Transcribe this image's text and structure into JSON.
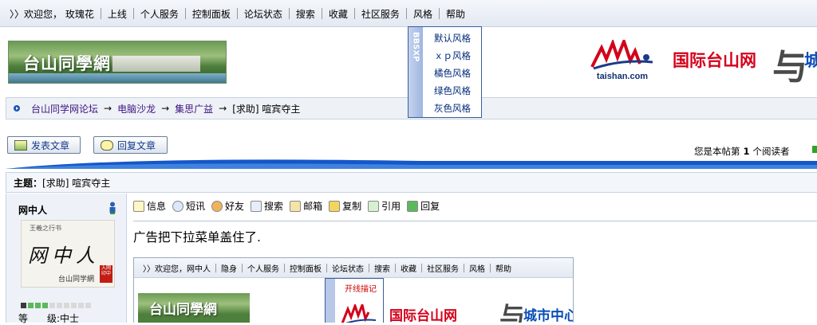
{
  "topnav": {
    "items": [
      "〉〉欢迎您， 玫瑰花",
      "上线",
      "个人服务",
      "控制面板",
      "论坛状态",
      "搜索",
      "收藏",
      "社区服务",
      "风格",
      "帮助"
    ]
  },
  "style_menu": {
    "strip_text": "BBSXP",
    "items": [
      "默认风格",
      "ｘｐ风格",
      "橘色风格",
      "绿色风格",
      "灰色风格"
    ]
  },
  "banner": {
    "logo_text": "台山同學網",
    "partner_domain": "taishan.com",
    "partner_name": "国际台山网",
    "partner_amp": "与",
    "partner_name2": "城"
  },
  "breadcrumb": {
    "links": [
      "台山同学网论坛",
      "电脑沙龙",
      "集思广益"
    ],
    "current": "[求助] 喧宾夺主"
  },
  "actions": {
    "post": "发表文章",
    "reply": "回复文章"
  },
  "readers": {
    "prefix": "您是本帖第",
    "count": "1",
    "suffix": "个阅读者"
  },
  "post": {
    "subject_label": "主题：",
    "subject": "[求助] 喧宾夺主",
    "author": "网中人",
    "avatar": {
      "caption": "王羲之行书",
      "big": "网中人",
      "sub": "台山同学網",
      "seal": "入网印中"
    },
    "level_label": "等　　级:",
    "level_value": "中士",
    "tools": [
      "信息",
      "短讯",
      "好友",
      "搜索",
      "邮箱",
      "复制",
      "引用",
      "回复"
    ],
    "text": "广告把下拉菜单盖住了."
  },
  "embedded": {
    "nav": [
      "〉〉欢迎您，网中人",
      "隐身",
      "个人服务",
      "控制面板",
      "论坛状态",
      "搜索",
      "收藏",
      "社区服务",
      "风格",
      "帮助"
    ],
    "logo_text": "台山同學網",
    "menu_item": "开线描记",
    "partner_name": "国际台山网",
    "partner_amp": "与",
    "partner_name2": "城市中心"
  }
}
